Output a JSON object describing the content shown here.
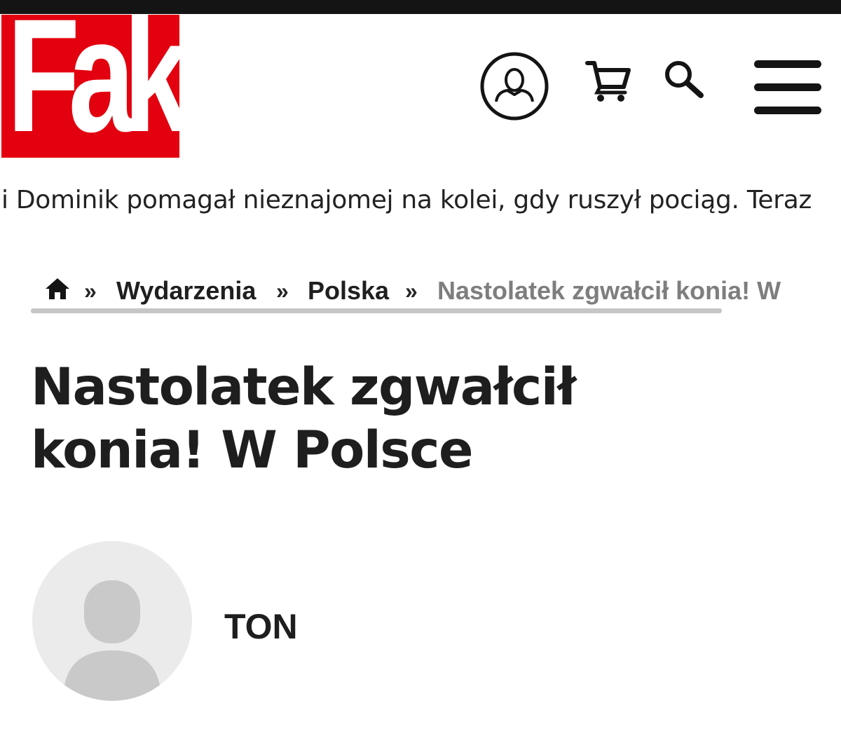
{
  "header": {
    "brand_name": "Fakt",
    "colors": {
      "brand": "#e3000f",
      "text": "#1f1f1f",
      "muted": "#7e7e7e",
      "divider": "#c6c6c6",
      "avatar_bg": "#ebebeb"
    },
    "icons": [
      "user-account-icon",
      "shopping-cart-icon",
      "search-icon",
      "hamburger-menu-icon"
    ]
  },
  "ticker": {
    "text": "i Dominik pomagał nieznajomej na kolei, gdy ruszył pociąg. Teraz"
  },
  "breadcrumb": {
    "home_icon": "home-icon",
    "separator": "»",
    "items": [
      "Wydarzenia",
      "Polska"
    ],
    "current": "Nastolatek zgwałcił konia! W"
  },
  "article": {
    "title_line1": "Nastolatek zgwałcił",
    "title_line2": "konia! W Polsce",
    "author": {
      "name": "TON",
      "avatar_icon": "default-avatar-icon"
    }
  }
}
